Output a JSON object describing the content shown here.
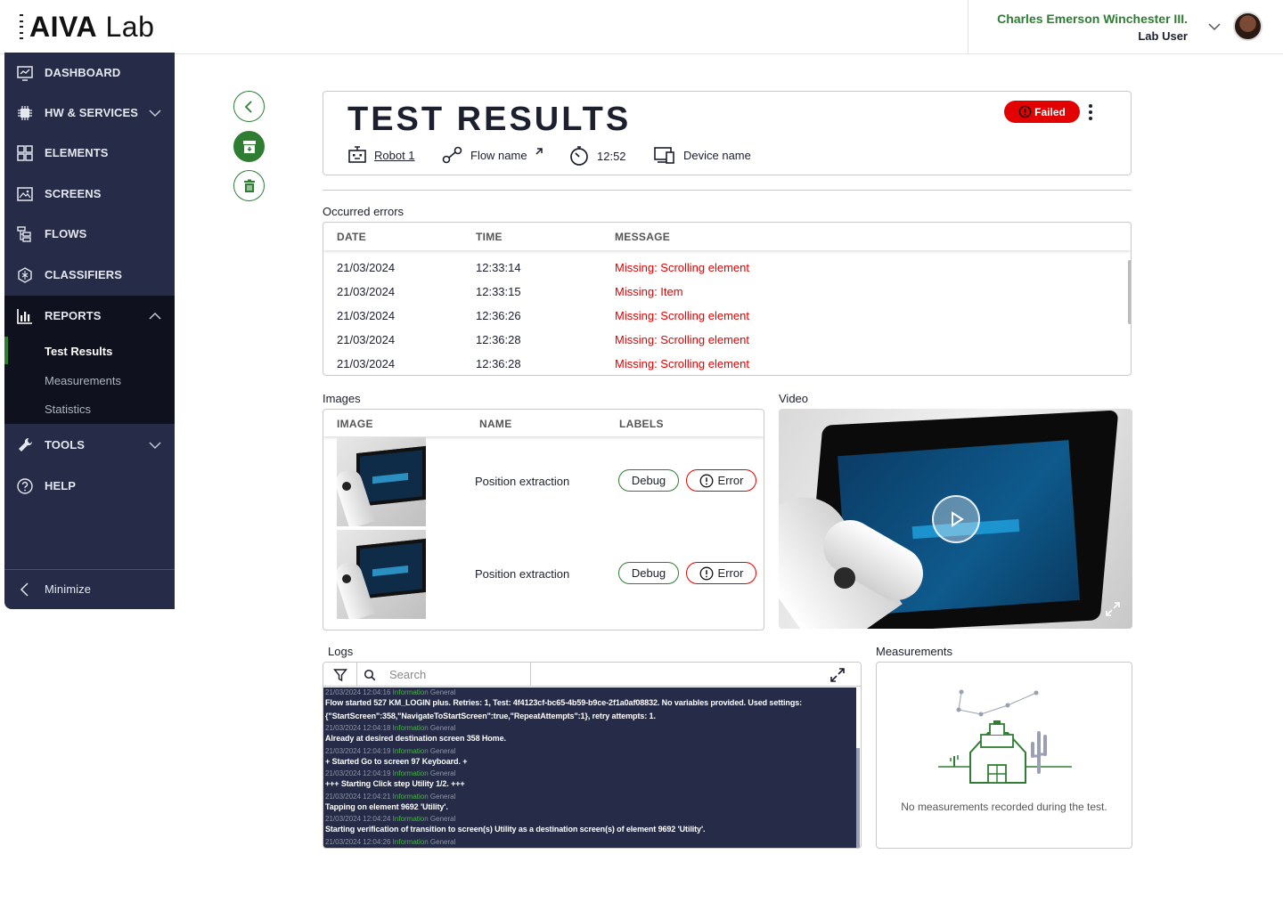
{
  "app": {
    "logo_bold": "AIVA",
    "logo_light": "Lab"
  },
  "user": {
    "name": "Charles Emerson Winchester III.",
    "role": "Lab User"
  },
  "sidebar": {
    "items": [
      {
        "label": "DASHBOARD",
        "icon": "dashboard-icon"
      },
      {
        "label": "HW & SERVICES",
        "icon": "chip-icon"
      },
      {
        "label": "ELEMENTS",
        "icon": "elements-icon"
      },
      {
        "label": "SCREENS",
        "icon": "screens-icon"
      },
      {
        "label": "FLOWS",
        "icon": "flows-icon"
      },
      {
        "label": "CLASSIFIERS",
        "icon": "classifiers-icon"
      },
      {
        "label": "REPORTS",
        "icon": "reports-icon"
      },
      {
        "label": "TOOLS",
        "icon": "wrench-icon"
      },
      {
        "label": "HELP",
        "icon": "help-icon"
      }
    ],
    "reports_sub": [
      "Test Results",
      "Measurements",
      "Statistics"
    ],
    "minimize": "Minimize"
  },
  "header": {
    "title": "TEST RESULTS",
    "status": "Failed",
    "robot": "Robot 1",
    "flow": "Flow name",
    "duration": "12:52",
    "device": "Device name"
  },
  "errors": {
    "label": "Occurred errors",
    "columns": [
      "DATE",
      "TIME",
      "MESSAGE"
    ],
    "rows": [
      {
        "date": "21/03/2024",
        "time": "12:33:14",
        "message": "Missing: Scrolling element"
      },
      {
        "date": "21/03/2024",
        "time": "12:33:15",
        "message": "Missing: Item"
      },
      {
        "date": "21/03/2024",
        "time": "12:36:26",
        "message": "Missing: Scrolling element"
      },
      {
        "date": "21/03/2024",
        "time": "12:36:28",
        "message": "Missing: Scrolling element"
      },
      {
        "date": "21/03/2024",
        "time": "12:36:28",
        "message": "Missing: Scrolling element"
      }
    ]
  },
  "images": {
    "label": "Images",
    "columns": [
      "IMAGE",
      "NAME",
      "LABELS"
    ],
    "rows": [
      {
        "name": "Position extraction",
        "labels": [
          "Debug",
          "Error"
        ]
      },
      {
        "name": "Position extraction",
        "labels": [
          "Debug",
          "Error"
        ]
      }
    ]
  },
  "video": {
    "label": "Video"
  },
  "logs": {
    "label": "Logs",
    "search_placeholder": "Search",
    "entries": [
      {
        "ts": "21/03/2024 12:04:16",
        "level": "Information",
        "cat": "General",
        "lines": [
          "Flow started 527 KM_LOGIN plus. Retries: 1, Test: 4f4123cf-bc65-4b59-b9ce-2f1a0af08832. No variables provided. Used settings:",
          "{\"StartScreen\":358,\"NavigateToStartScreen\":true,\"RepeatAttempts\":1}, retry attempts: 1."
        ]
      },
      {
        "ts": "21/03/2024 12:04:18",
        "level": "Information",
        "cat": "General",
        "lines": [
          "Already at desired destination screen 358 Home."
        ]
      },
      {
        "ts": "21/03/2024 12:04:19",
        "level": "Information",
        "cat": "General",
        "lines": [
          "+ Started Go to screen 97 Keyboard. +"
        ]
      },
      {
        "ts": "21/03/2024 12:04:19",
        "level": "Information",
        "cat": "General",
        "lines": [
          "+++ Starting Click step Utility 1/2. +++"
        ]
      },
      {
        "ts": "21/03/2024 12:04:21",
        "level": "Information",
        "cat": "General",
        "lines": [
          "Tapping on element 9692 'Utility'."
        ]
      },
      {
        "ts": "21/03/2024 12:04:24",
        "level": "Information",
        "cat": "General",
        "lines": [
          "Starting verification of transition to screen(s) Utility as a destination screen(s) of element 9692 'Utility'."
        ]
      },
      {
        "ts": "21/03/2024 12:04:26",
        "level": "Information",
        "cat": "General",
        "lines": []
      }
    ]
  },
  "measurements": {
    "label": "Measurements",
    "empty": "No measurements recorded during the test."
  },
  "colors": {
    "brand_green": "#2e7d32",
    "error_red": "#e30000",
    "sidebar_bg": "#262c47"
  }
}
